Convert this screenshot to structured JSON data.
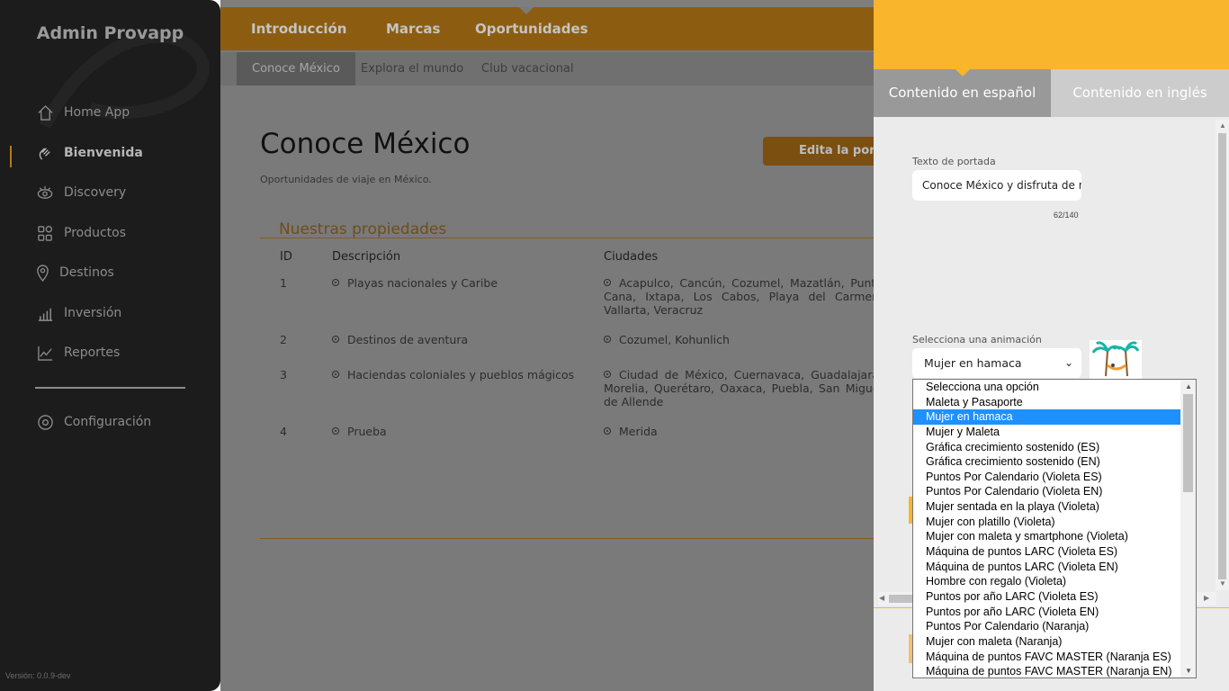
{
  "sidebar": {
    "brand": "Admin Provapp",
    "items": [
      {
        "label": "Home App",
        "icon": "home-icon"
      },
      {
        "label": "Bienvenida",
        "icon": "waving-hand-icon"
      },
      {
        "label": "Discovery",
        "icon": "eye-icon"
      },
      {
        "label": "Productos",
        "icon": "grid-icon"
      },
      {
        "label": "Destinos",
        "icon": "location-pin-icon"
      },
      {
        "label": "Inversión",
        "icon": "bar-chart-icon"
      },
      {
        "label": "Reportes",
        "icon": "line-chart-icon"
      }
    ],
    "settings": {
      "label": "Configuración",
      "icon": "gear-icon"
    },
    "version": "Versión: 0.0.9-dev"
  },
  "topnav": {
    "tabs": [
      "Introducción",
      "Marcas",
      "Oportunidades"
    ]
  },
  "subnav": {
    "tabs": [
      "Conoce México",
      "Explora el mundo",
      "Club vacacional"
    ]
  },
  "page": {
    "title": "Conoce México",
    "subtitle": "Oportunidades de viaje en México.",
    "edit_button": "Edita la portada",
    "section_title": "Nuestras propiedades"
  },
  "table": {
    "headers": [
      "ID",
      "Descripción",
      "Ciudades"
    ],
    "rows": [
      {
        "id": "1",
        "desc": "Playas nacionales y Caribe",
        "cities": "Acapulco, Cancún, Cozumel, Mazatlán, Punta Cana, Ixtapa, Los Cabos, Playa del Carmen, Vallarta, Veracruz"
      },
      {
        "id": "2",
        "desc": "Destinos de aventura",
        "cities": "Cozumel, Kohunlich"
      },
      {
        "id": "3",
        "desc": "Haciendas coloniales y pueblos mágicos",
        "cities": "Ciudad de México, Cuernavaca, Guadalajara, Morelia, Querétaro, Oaxaca, Puebla, San Miguel de Allende"
      },
      {
        "id": "4",
        "desc": "Prueba",
        "cities": "Merida"
      }
    ]
  },
  "panel": {
    "tab_es": "Contenido en español",
    "tab_en": "Contenido en inglés",
    "cover_label": "Texto de portada",
    "cover_value": "Conoce México y disfruta de nuestros destinos",
    "counter": "62/140",
    "animation_label": "Selecciona una animación",
    "animation_selected": "Mujer en hamaca"
  },
  "dropdown": {
    "selected_index": 2,
    "options": [
      "Selecciona una opción",
      "Maleta y Pasaporte",
      "Mujer en hamaca",
      "Mujer y Maleta",
      "Gráfica crecimiento sostenido (ES)",
      "Gráfica crecimiento sostenido (EN)",
      "Puntos Por Calendario (Violeta ES)",
      "Puntos Por Calendario (Violeta EN)",
      "Mujer sentada en la playa (Violeta)",
      "Mujer con platillo (Violeta)",
      "Mujer con maleta y smartphone (Violeta)",
      "Máquina de puntos LARC (Violeta ES)",
      "Máquina de puntos LARC (Violeta EN)",
      "Hombre con regalo (Violeta)",
      "Puntos por año LARC (Violeta ES)",
      "Puntos por año LARC (Violeta EN)",
      "Puntos Por Calendario (Naranja)",
      "Mujer con maleta (Naranja)",
      "Máquina de puntos FAVC MASTER (Naranja ES)",
      "Máquina de puntos FAVC MASTER (Naranja EN)"
    ]
  },
  "colors": {
    "accent": "#f9b52c",
    "sidebar_bg": "#1c1c1c",
    "selected_option": "#1e90ff"
  }
}
